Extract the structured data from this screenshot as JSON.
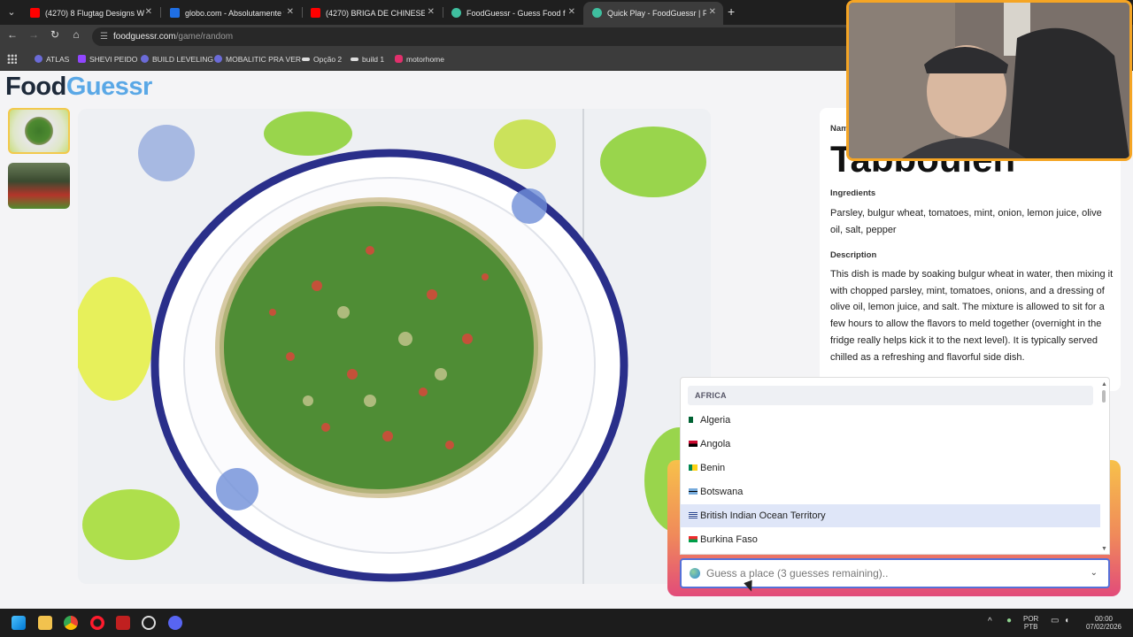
{
  "browser": {
    "tabs": [
      {
        "title": "(4270) 8 Flugtag Designs We'll",
        "favicon_color": "#ff0000"
      },
      {
        "title": "globo.com - Absolutamente tu",
        "favicon_color": "#1f6fe5"
      },
      {
        "title": "(4270) BRIGA DE CHINESES - Y",
        "favicon_color": "#ff0000"
      },
      {
        "title": "FoodGuessr - Guess Food from",
        "favicon_color": "#3fbf9f"
      },
      {
        "title": "Quick Play - FoodGuessr | Food",
        "favicon_color": "#3fbf9f"
      }
    ],
    "active_tab_index": 4,
    "url_prefix": "foodguessr.com",
    "url_path": "/game/random",
    "bookmarks": [
      {
        "label": "ATLAS",
        "icon_color": "#6b6bd8"
      },
      {
        "label": "SHEVI PEIDO",
        "icon_color": "#9146ff"
      },
      {
        "label": "BUILD LEVELING",
        "icon_color": "#6b6bd8"
      },
      {
        "label": "MOBALITIC PRA VER",
        "icon_color": "#6b6bd8"
      },
      {
        "label": "Opção 2",
        "icon_color": "#dddddd"
      },
      {
        "label": "build 1",
        "icon_color": "#dddddd"
      },
      {
        "label": "motorhome",
        "icon_color": "#e1306c"
      }
    ]
  },
  "app": {
    "logo_part1": "Food",
    "logo_part2": "Guessr",
    "brand_dark": "#1e2a3a",
    "brand_light": "#5aa8e6"
  },
  "dish": {
    "name_label": "Nam",
    "name": "Tabbouleh",
    "ingredients_label": "Ingredients",
    "ingredients": "Parsley, bulgur wheat, tomatoes, mint, onion, lemon juice, olive oil, salt, pepper",
    "description_label": "Description",
    "description": "This dish is made by soaking bulgur wheat in water, then mixing it with chopped parsley, mint, tomatoes, onions, and a dressing of olive oil, lemon juice, and salt. The mixture is allowed to sit for a few hours to allow the flavors to meld together (overnight in the fridge really helps kick it to the next level). It is typically served chilled as a refreshing and flavorful side dish."
  },
  "guess": {
    "group_label": "AFRICA",
    "options": [
      "Algeria",
      "Angola",
      "Benin",
      "Botswana",
      "British Indian Ocean Territory",
      "Burkina Faso"
    ],
    "highlighted_option": "British Indian Ocean Territory",
    "placeholder": "Guess a place (3 guesses remaining)..",
    "input_border_color": "#5570d8"
  },
  "taskbar": {
    "lang_top": "POR",
    "lang_bottom": "PTB",
    "time": "00:00",
    "date": "07/02/2026"
  }
}
